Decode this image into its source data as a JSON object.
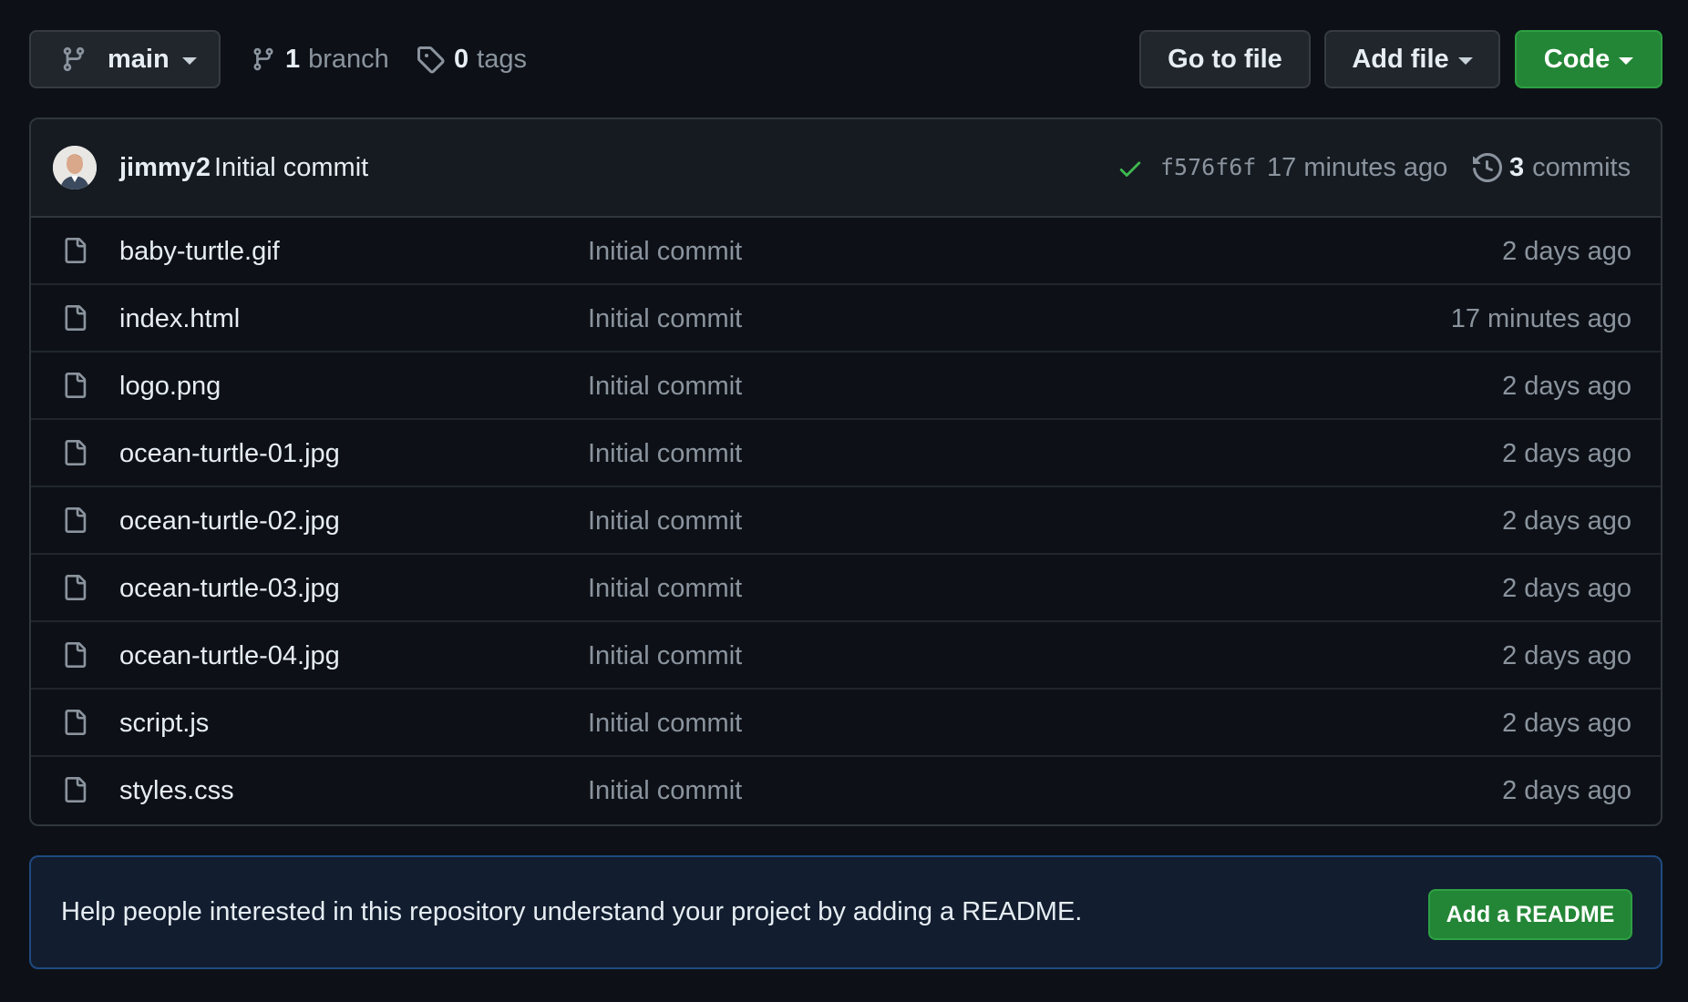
{
  "toolbar": {
    "branch_name": "main",
    "branch_count": "1",
    "branch_label": "branch",
    "tag_count": "0",
    "tag_label": "tags",
    "goto_file_label": "Go to file",
    "add_file_label": "Add file",
    "code_label": "Code"
  },
  "latest_commit": {
    "author": "jimmy2",
    "message": "Initial commit",
    "status": "success",
    "sha": "f576f6f",
    "time": "17 minutes ago",
    "commit_count": "3",
    "commit_label": "commits"
  },
  "files": [
    {
      "name": "baby-turtle.gif",
      "commit": "Initial commit",
      "age": "2 days ago"
    },
    {
      "name": "index.html",
      "commit": "Initial commit",
      "age": "17 minutes ago"
    },
    {
      "name": "logo.png",
      "commit": "Initial commit",
      "age": "2 days ago"
    },
    {
      "name": "ocean-turtle-01.jpg",
      "commit": "Initial commit",
      "age": "2 days ago"
    },
    {
      "name": "ocean-turtle-02.jpg",
      "commit": "Initial commit",
      "age": "2 days ago"
    },
    {
      "name": "ocean-turtle-03.jpg",
      "commit": "Initial commit",
      "age": "2 days ago"
    },
    {
      "name": "ocean-turtle-04.jpg",
      "commit": "Initial commit",
      "age": "2 days ago"
    },
    {
      "name": "script.js",
      "commit": "Initial commit",
      "age": "2 days ago"
    },
    {
      "name": "styles.css",
      "commit": "Initial commit",
      "age": "2 days ago"
    }
  ],
  "readme_banner": {
    "text": "Help people interested in this repository understand your project by adding a README.",
    "button_label": "Add a README"
  },
  "icons": {
    "branch": "git-branch-icon",
    "tag": "tag-icon",
    "check": "check-icon",
    "history": "history-icon",
    "file": "file-icon"
  },
  "colors": {
    "background": "#0d1117",
    "header_bg": "#161b22",
    "border": "#30363d",
    "primary_button": "#238636",
    "success": "#3fb950",
    "muted_text": "#8b949e",
    "banner_bg": "#121d2f",
    "banner_border": "#1f4a80"
  }
}
